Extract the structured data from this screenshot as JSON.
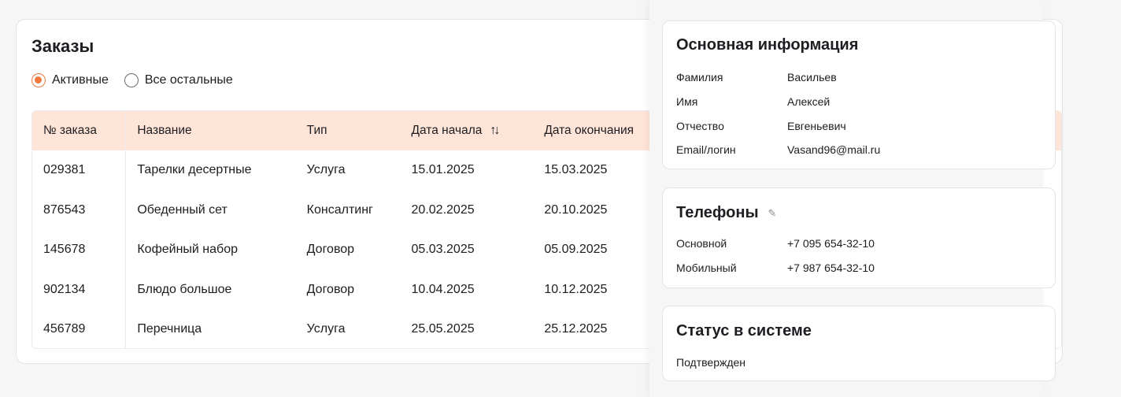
{
  "orders": {
    "title": "Заказы",
    "filters": [
      {
        "label": "Активные",
        "checked": true
      },
      {
        "label": "Все остальные",
        "checked": false
      }
    ],
    "table": {
      "headers": [
        "№ заказа",
        "Название",
        "Тип",
        "Дата начала",
        "Дата окончания"
      ],
      "rows": [
        [
          "029381",
          "Тарелки десертные",
          "Услуга",
          "15.01.2025",
          "15.03.2025"
        ],
        [
          "876543",
          "Обеденный сет",
          "Консалтинг",
          "20.02.2025",
          "20.10.2025"
        ],
        [
          "145678",
          "Кофейный набор",
          "Договор",
          "05.03.2025",
          "05.09.2025"
        ],
        [
          "902134",
          "Блюдо большое",
          "Договор",
          "10.04.2025",
          "10.12.2025"
        ],
        [
          "456789",
          "Перечница",
          "Услуга",
          "25.05.2025",
          "25.12.2025"
        ]
      ],
      "sort_icon": "sort-arrows-icon"
    }
  },
  "side_panel": {
    "main_info": {
      "title": "Основная информация",
      "fields": [
        {
          "key": "Фамилия",
          "value": "Васильев"
        },
        {
          "key": "Имя",
          "value": "Алексей"
        },
        {
          "key": "Отчество",
          "value": "Евгеньевич"
        },
        {
          "key": "Email/логин",
          "value": "Vasand96@mail.ru"
        }
      ]
    },
    "phones": {
      "title": "Телефоны",
      "edit_icon": "pencil-icon",
      "fields": [
        {
          "key": "Основной",
          "value": "+7 095 654-32-10"
        },
        {
          "key": "Мобильный",
          "value": "+7 987 654-32-10"
        }
      ]
    },
    "status": {
      "title": "Статус в системе",
      "value": "Подтвержден"
    }
  },
  "colors": {
    "accent": "#f07a3c",
    "table_header_bg": "#ffe4d8",
    "background": "#f6f6f6",
    "card_bg": "#ffffff",
    "text": "#1d1d22"
  }
}
